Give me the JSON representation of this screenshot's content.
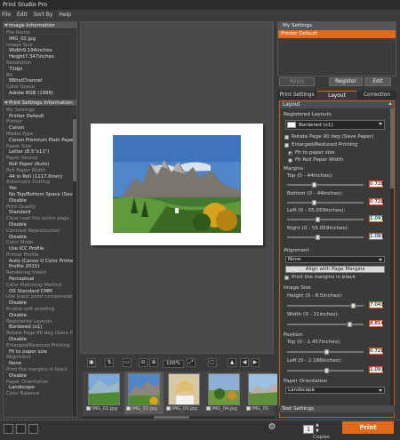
{
  "app": {
    "title": "Print Studio Pro"
  },
  "menu": {
    "file": "File",
    "edit": "Edit",
    "sortby": "Sort By",
    "help": "Help"
  },
  "image_info": {
    "header": "Image Information",
    "rows": [
      {
        "label": "File Name",
        "value": "IMG_02.jpg"
      },
      {
        "label": "Image Size",
        "value": "Width9.194inches"
      },
      {
        "label": "",
        "value": "Height7.347inches"
      },
      {
        "label": "Resolution",
        "value": "72dpi"
      },
      {
        "label": "Bit",
        "value": "8Bits/Channel"
      },
      {
        "label": "Color Space",
        "value": "Adobe RGB (1998)"
      }
    ]
  },
  "print_info": {
    "header": "Print Settings Information",
    "rows": [
      {
        "label": "My Settings",
        "value": "Printer Default"
      },
      {
        "label": "Printer",
        "value": "Canon"
      },
      {
        "label": "Media Type",
        "value": "Canon Premium Plain Paper 80"
      },
      {
        "label": "Paper Size",
        "value": "Letter (8.5\"x11\")"
      },
      {
        "label": "Paper Source",
        "value": "Roll Paper (Auto)"
      },
      {
        "label": "Roll Paper Width",
        "value": "44 in Roll (1117.6mm)"
      },
      {
        "label": "Automatic Cutting",
        "value": "Yes"
      },
      {
        "label": "",
        "value": "No Top/Bottom Space (Save Paper)"
      },
      {
        "label": "",
        "value": "Disable"
      },
      {
        "label": "Print Quality",
        "value": "Standard"
      },
      {
        "label": "Clear coat the entire page",
        "value": "Disable"
      },
      {
        "label": "Contrast Reproduction",
        "value": "Disable"
      },
      {
        "label": "Color Mode",
        "value": "Use ICC Profile"
      },
      {
        "label": "Printer Profile",
        "value": "Auto (Canon U Color Printer"
      },
      {
        "label": "",
        "value": "Profile 2015)"
      },
      {
        "label": "Rendering Intent",
        "value": "Perceptual"
      },
      {
        "label": "Color Matching Method",
        "value": "OS Standard CMM"
      },
      {
        "label": "Use black point compensation",
        "value": "Disable"
      },
      {
        "label": "Enable soft proofing",
        "value": "Disable"
      },
      {
        "label": "Registered Layouts",
        "value": "Bordered (x1)"
      },
      {
        "label": "Rotate Page 90 deg (Save Paper)",
        "value": "Disable"
      },
      {
        "label": "Enlarged/Reduced Printing",
        "value": "Fit to paper size"
      },
      {
        "label": "Alignment",
        "value": "None"
      },
      {
        "label": "Print the margins in black",
        "value": "Disable"
      },
      {
        "label": "Paper Orientation",
        "value": "Landscape"
      },
      {
        "label": "Color Balance",
        "value": ""
      }
    ]
  },
  "preview": {
    "zoom": "100%"
  },
  "thumbnails": [
    {
      "name": "IMG_01.jpg"
    },
    {
      "name": "IMG_02.jpg"
    },
    {
      "name": "IMG_03.jpg"
    },
    {
      "name": "IMG_04.jpg"
    },
    {
      "name": "IMG_05"
    }
  ],
  "my_settings": {
    "header": "My Settings",
    "selected": "Printer Default",
    "apply": "Apply",
    "register": "Register",
    "edit": "Edit"
  },
  "tabs": {
    "print_settings": "Print Settings",
    "layout": "Layout",
    "correction": "Correction"
  },
  "layout": {
    "header": "Layout",
    "registered_layouts_label": "Registered Layouts",
    "registered_layouts_value": "Bordered (x1)",
    "rotate_label": "Rotate Page 90 deg (Save Paper)",
    "enlarged_label": "Enlarged/Reduced Printing",
    "fit_paper": "Fit to paper size",
    "fit_roll": "Fit Roll Paper Width",
    "margins_label": "Margins",
    "top_margin_label": "Top (0 - 44inches):",
    "top_margin": "0.728",
    "bottom_margin_label": "Bottom (0 - 44inches):",
    "bottom_margin": "0.728",
    "left_margin_label": "Left (0 - 55.059inches):",
    "left_margin": "1.093",
    "right_margin_label": "Right (0 - 55.059inches):",
    "right_margin": "1.093",
    "alignment_label": "Alignment",
    "alignment_value": "None",
    "align_btn": "Align with Page Margins",
    "print_margins_black": "Print the margins in black",
    "image_size_label": "Image Size",
    "height_label": "Height (0 - 8.5inches):",
    "height_value": "7.043",
    "width_label": "Width (0 - 11inches):",
    "width_value": "8.814",
    "position_label": "Position",
    "pos_top_label": "Top (0 - 1.457inches):",
    "pos_top": "0.728",
    "pos_left_label": "Left (0 - 2.186inches):",
    "pos_left": "1.093",
    "orientation_label": "Paper Orientation",
    "orientation_value": "Landscape"
  },
  "text_settings": "Text Settings",
  "bottom": {
    "copies_value": "1",
    "copies_label": "Copies",
    "print": "Print"
  },
  "colors": {
    "accent": "#e06a1a"
  }
}
